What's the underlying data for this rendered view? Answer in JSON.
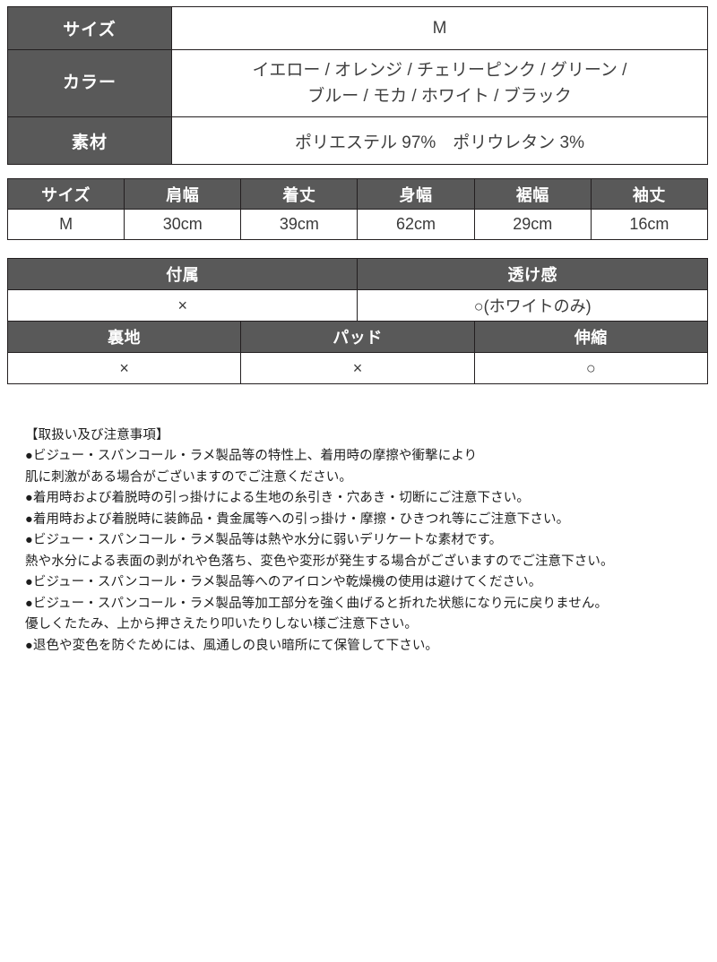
{
  "basic_table": {
    "rows": [
      {
        "label": "サイズ",
        "value": "M",
        "value_lines": [
          "M"
        ]
      },
      {
        "label": "カラー",
        "value": "イエロー / オレンジ / チェリーピンク / グリーン / ブルー / モカ / ホワイト / ブラック",
        "value_lines": [
          "イエロー / オレンジ / チェリーピンク / グリーン /",
          "ブルー / モカ / ホワイト / ブラック"
        ]
      },
      {
        "label": "素材",
        "value": "ポリエステル 97%　ポリウレタン 3%",
        "value_lines": [
          "ポリエステル 97%　ポリウレタン 3%"
        ]
      }
    ]
  },
  "measure_table": {
    "headers": [
      "サイズ",
      "肩幅",
      "着丈",
      "身幅",
      "裾幅",
      "袖丈"
    ],
    "values": [
      "M",
      "30cm",
      "39cm",
      "62cm",
      "29cm",
      "16cm"
    ]
  },
  "attr_table": {
    "group1_headers": [
      "付属",
      "透け感"
    ],
    "group1_values": [
      "×",
      "○(ホワイトのみ)"
    ],
    "group2_headers": [
      "裏地",
      "パッド",
      "伸縮"
    ],
    "group2_values": [
      "×",
      "×",
      "○"
    ]
  },
  "notes": {
    "heading": "【取扱い及び注意事項】",
    "lines": [
      "●ビジュー・スパンコール・ラメ製品等の特性上、着用時の摩擦や衝撃により",
      "肌に刺激がある場合がございますのでご注意ください。",
      "●着用時および着脱時の引っ掛けによる生地の糸引き・穴あき・切断にご注意下さい。",
      "●着用時および着脱時に装飾品・貴金属等への引っ掛け・摩擦・ひきつれ等にご注意下さい。",
      "●ビジュー・スパンコール・ラメ製品等は熱や水分に弱いデリケートな素材です。",
      "熱や水分による表面の剥がれや色落ち、変色や変形が発生する場合がございますのでご注意下さい。",
      "●ビジュー・スパンコール・ラメ製品等へのアイロンや乾燥機の使用は避けてください。",
      "●ビジュー・スパンコール・ラメ製品等加工部分を強く曲げると折れた状態になり元に戻りません。",
      "優しくたたみ、上から押さえたり叩いたりしない様ご注意下さい。",
      "●退色や変色を防ぐためには、風通しの良い暗所にて保管して下さい。"
    ]
  },
  "colors": {
    "header_bg": "#595959",
    "border": "#231f20",
    "header_text": "#ffffff",
    "body_text": "#3a3a3a",
    "notes_text": "#1d1d1d",
    "page_bg": "#ffffff"
  }
}
